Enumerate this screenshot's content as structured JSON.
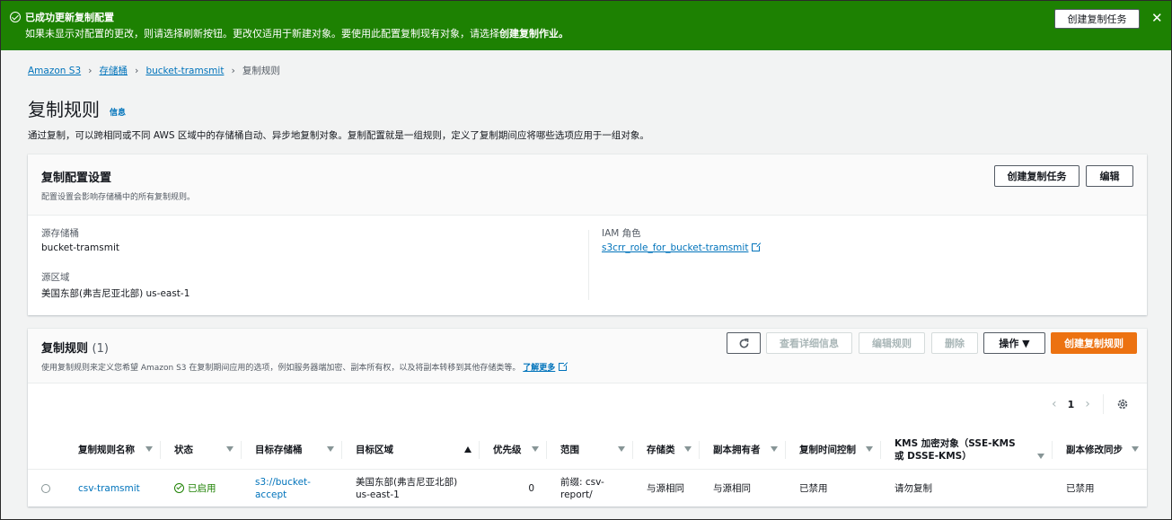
{
  "flash": {
    "title": "已成功更新复制配置",
    "msg_part1": "如果未显示对配置的更改，则请选择刷新按钮。更改仅适用于新建对象。要使用此配置复制现有对象，请选择",
    "msg_bold": "创建复制作业。",
    "button": "创建复制任务",
    "close": "✕"
  },
  "breadcrumb": {
    "items": [
      "Amazon S3",
      "存储桶",
      "bucket-tramsmit"
    ],
    "current": "复制规则",
    "sep": "›"
  },
  "page": {
    "title": "复制规则",
    "info": "信息",
    "description": "通过复制，可以跨相同或不同 AWS 区域中的存储桶自动、异步地复制对象。复制配置就是一组规则，定义了复制期间应将哪些选项应用于一组对象。"
  },
  "config": {
    "title": "复制配置设置",
    "subtitle": "配置设置会影响存储桶中的所有复制规则。",
    "create_job": "创建复制任务",
    "edit": "编辑",
    "source_bucket_label": "源存储桶",
    "source_bucket": "bucket-tramsmit",
    "source_region_label": "源区域",
    "source_region": "美国东部(弗吉尼亚北部) us-east-1",
    "iam_label": "IAM 角色",
    "iam_role": "s3crr_role_for_bucket-tramsmit"
  },
  "rules": {
    "title": "复制规则",
    "count": "(1)",
    "subtitle": "使用复制规则来定义您希望 Amazon S3 在复制期间应用的选项，例如服务器端加密、副本所有权，以及将副本转移到其他存储类等。",
    "learn_more": "了解更多",
    "btn_view": "查看详细信息",
    "btn_edit": "编辑规则",
    "btn_delete": "删除",
    "btn_actions": "操作 ▼",
    "btn_create": "创建复制规则",
    "page": "1",
    "columns": [
      "复制规则名称",
      "状态",
      "目标存储桶",
      "目标区域",
      "优先级",
      "范围",
      "存储类",
      "副本拥有者",
      "复制时间控制",
      "KMS 加密对象（SSE-KMS 或 DSSE-KMS）",
      "副本修改同步"
    ],
    "row": {
      "name": "csv-tramsmit",
      "status": "已启用",
      "dest_bucket": "s3://bucket-accept",
      "dest_region": "美国东部(弗吉尼亚北部) us-east-1",
      "priority": "0",
      "scope": "前缀: csv-report/",
      "storage_class": "与源相同",
      "owner": "与源相同",
      "rtc": "已禁用",
      "kms": "请勿复制",
      "replica_sync": "已禁用"
    }
  }
}
